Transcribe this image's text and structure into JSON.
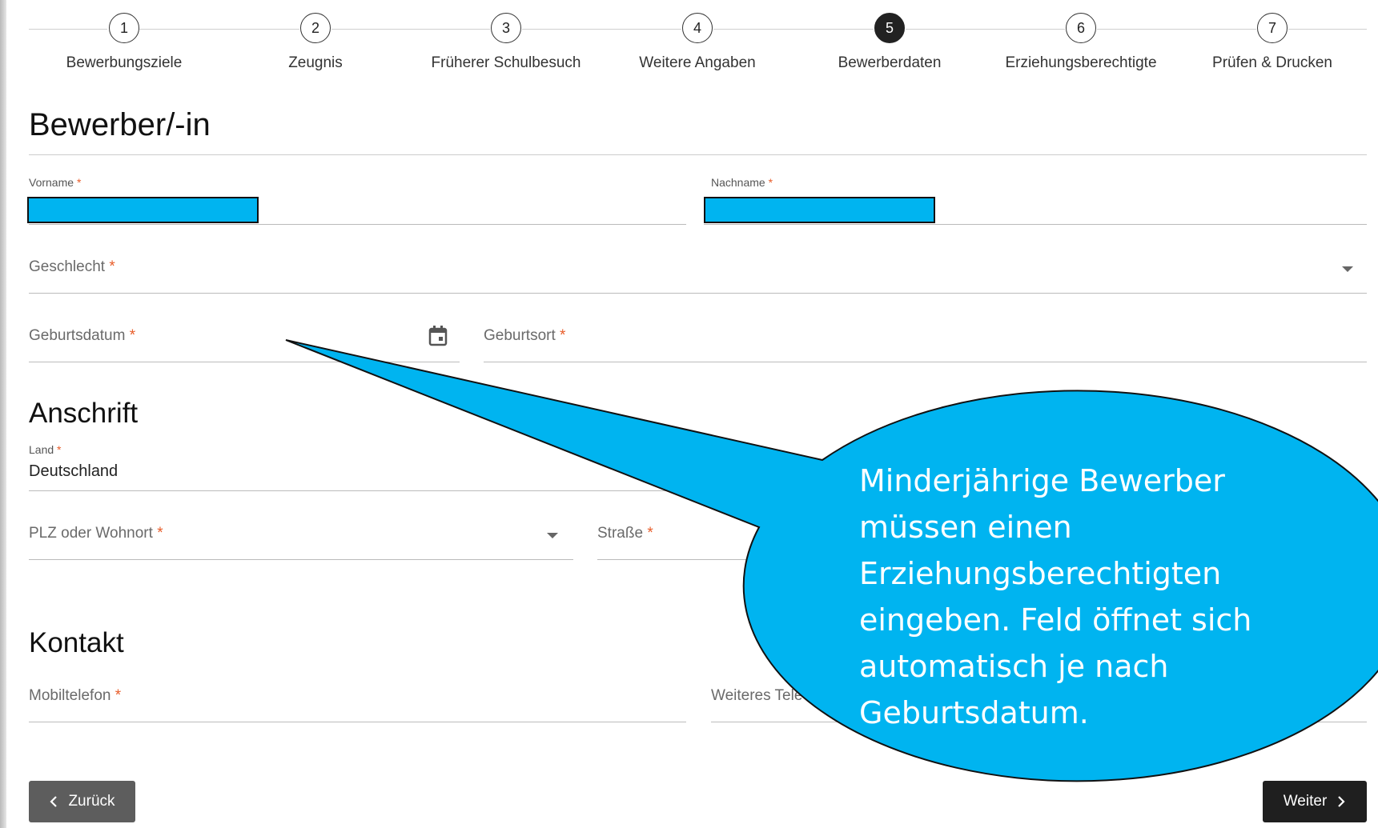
{
  "stepper": {
    "steps": [
      {
        "number": "1",
        "label": "Bewerbungsziele"
      },
      {
        "number": "2",
        "label": "Zeugnis"
      },
      {
        "number": "3",
        "label": "Früherer Schulbesuch"
      },
      {
        "number": "4",
        "label": "Weitere Angaben"
      },
      {
        "number": "5",
        "label": "Bewerberdaten"
      },
      {
        "number": "6",
        "label": "Erziehungsberechtigte"
      },
      {
        "number": "7",
        "label": "Prüfen & Drucken"
      }
    ],
    "active_step": "5"
  },
  "applicant": {
    "heading": "Bewerber/-in",
    "first_name_label": "Vorname",
    "last_name_label": "Nachname",
    "gender_label": "Geschlecht",
    "birthdate_label": "Geburtsdatum",
    "birthplace_label": "Geburtsort"
  },
  "address": {
    "heading": "Anschrift",
    "country_label": "Land",
    "country_value": "Deutschland",
    "zip_city_label": "PLZ oder Wohnort",
    "street_label": "Straße"
  },
  "contact": {
    "heading": "Kontakt",
    "mobile_label": "Mobiltelefon",
    "other_phone_label": "Weiteres Tele"
  },
  "required_marker": "*",
  "buttons": {
    "back": "Zurück",
    "next": "Weiter"
  },
  "callout": {
    "lines": [
      "Minderjährige Bewerber",
      "müssen einen",
      "Erziehungsberechtigten",
      "eingeben. Feld öffnet sich",
      "automatisch je nach",
      "Geburtsdatum."
    ]
  },
  "colors": {
    "callout_fill": "#00b4f0",
    "required": "#e85d2a",
    "active_step": "#222222"
  },
  "icons": [
    "calendar-icon",
    "chevron-down-icon",
    "chevron-left-icon",
    "chevron-right-icon"
  ]
}
